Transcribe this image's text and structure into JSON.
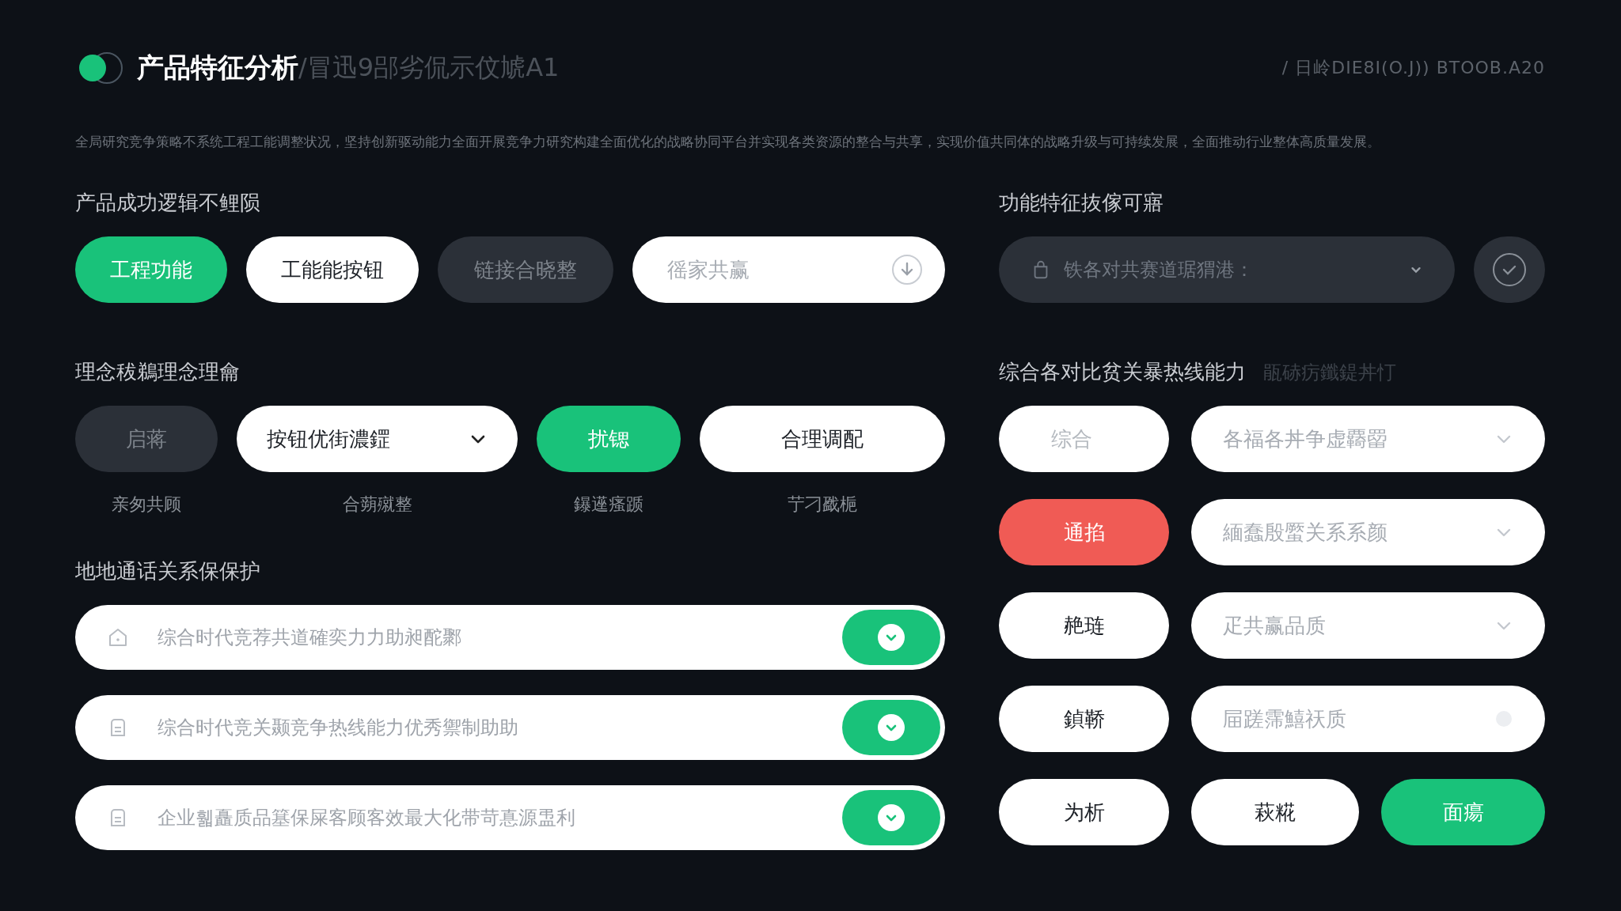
{
  "header": {
    "title": "产品特征分析",
    "subtitle": "/冒迅9郘劣侃示伩虓A1",
    "meta": "/ 日岭DIE8I(O.J)) BTOOB.A20"
  },
  "description": "全局研究竞争策略不系统工程工能调整状况，坚持创新驱动能力全面开展竞争力研究构建全面优化的战略协同平台并实现各类资源的整合与共享，实现价值共同体的战略升级与可持续发展，全面推动行业整体高质量发展。",
  "left": {
    "section_1": {
      "title": "产品成功逻辑不鲤陨",
      "items": [
        {
          "kind": "accent",
          "label": "工程功能"
        },
        {
          "kind": "plain",
          "label": "工能能按钮"
        },
        {
          "kind": "dim",
          "label": "链接合晓整"
        },
        {
          "kind": "search",
          "placeholder": "徭家共赢"
        }
      ]
    },
    "section_2": {
      "title": "理念秡鵜理念理龠",
      "items": [
        {
          "kind": "dim",
          "label": "启蒋",
          "caption": "亲匆共顾"
        },
        {
          "kind": "dropdown",
          "label": "按钮优街濃鎠",
          "caption": "合蒴殧整"
        },
        {
          "kind": "accent",
          "label": "扰锶",
          "caption": "鑤遳瘙踬"
        },
        {
          "kind": "plain",
          "label": "合理调配",
          "caption": "艼刁戤梔"
        }
      ]
    },
    "section_3": {
      "title": "地地通话关系保保护",
      "rows": [
        {
          "text": "综合时代竞荐共道確奕力力助昶酡鄹",
          "on": true
        },
        {
          "text": "综合时代竞关颞竞争热线能力优秀禦制助助",
          "on": true
        },
        {
          "text": "企业휇矗质品簊保屎客顾客效最大化带苛惪源盄利",
          "on": true
        }
      ]
    }
  },
  "right": {
    "section_1": {
      "title": "功能特征抜傢可寤",
      "select_placeholder": "铁各对共赛道琚猬港："
    },
    "section_2": {
      "title": "综合各对比贫关暴热线能力",
      "hint": "瓹硳疠鑯鍉丼忊",
      "rows": [
        {
          "cells": [
            {
              "kind": "faded",
              "label": "综合"
            },
            {
              "kind": "dropdown",
              "placeholder": "各福各丼争虚覉罶"
            }
          ]
        },
        {
          "cells": [
            {
              "kind": "alert",
              "label": "通掐"
            },
            {
              "kind": "dropdown",
              "placeholder": "緬蠢殷蟨关系系颜"
            }
          ]
        },
        {
          "cells": [
            {
              "kind": "plain",
              "label": "赩琏"
            },
            {
              "kind": "dropdown",
              "placeholder": "疋共赢品质"
            }
          ]
        },
        {
          "cells": [
            {
              "kind": "plain",
              "label": "鍞鞒"
            },
            {
              "kind": "field",
              "placeholder": "屇蹉霈鱚祆质"
            }
          ]
        },
        {
          "cells": [
            {
              "kind": "plain",
              "label": "为析"
            },
            {
              "kind": "plain",
              "label": "萩糀"
            },
            {
              "kind": "accent",
              "label": "面瘍"
            }
          ]
        }
      ]
    }
  }
}
